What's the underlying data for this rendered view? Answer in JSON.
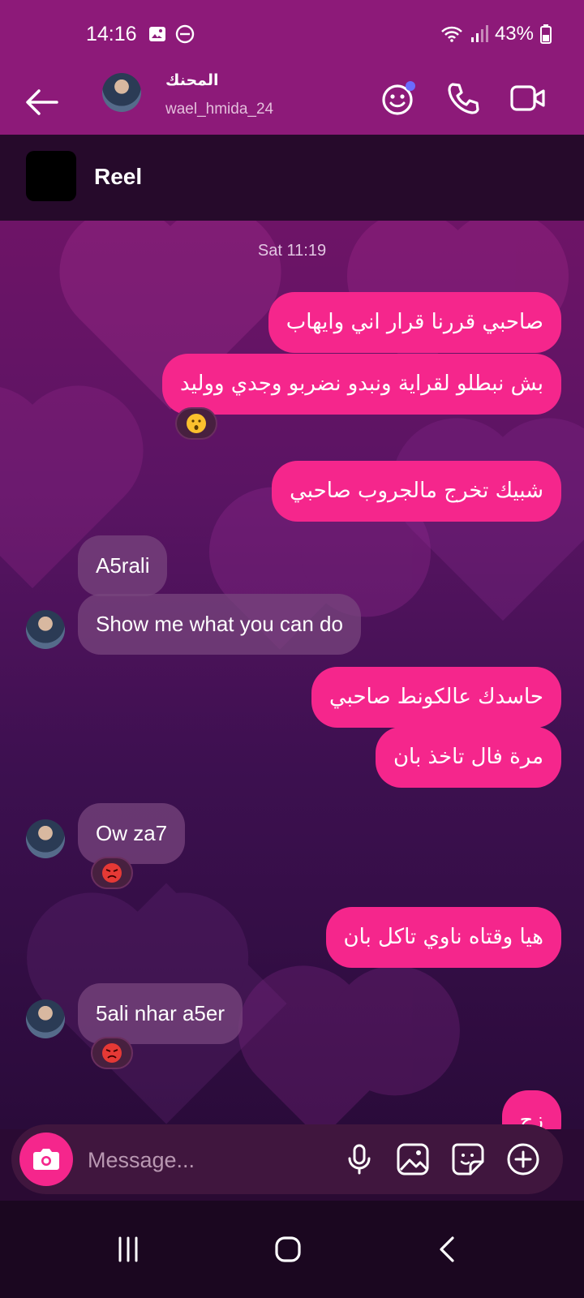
{
  "status_bar": {
    "time": "14:16",
    "battery": "43%"
  },
  "header": {
    "name": "المحنك",
    "handle": "wael_hmida_24"
  },
  "reel": {
    "label": "Reel"
  },
  "chat": {
    "timestamp": "Sat 11:19",
    "messages": [
      {
        "text": "صاحبي قررنا قرار اني وايهاب"
      },
      {
        "text": "بش نبطلو لقراية ونبدو نضربو وجدي ووليد"
      },
      {
        "text": "شبيك تخرج مالجروب صاحبي"
      },
      {
        "text": "A5rali"
      },
      {
        "text": "Show me what you can do"
      },
      {
        "text": "حاسدك عالكونط صاحبي"
      },
      {
        "text": "مرة فال تاخذ بان"
      },
      {
        "text": "Ow za7"
      },
      {
        "text": "هيا وقتاه ناوي تاكل بان"
      },
      {
        "text": "5ali nhar a5er"
      },
      {
        "text": "زح"
      }
    ]
  },
  "composer": {
    "placeholder": "Message..."
  },
  "colors": {
    "accent": "#f5268c",
    "header": "#8d1a79"
  }
}
